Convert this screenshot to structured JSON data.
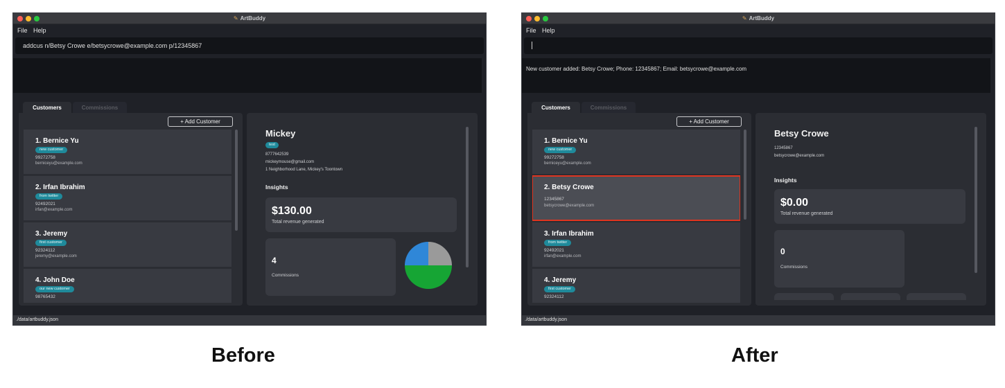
{
  "before": {
    "app_title": "ArtBuddy",
    "menu": [
      "File",
      "Help"
    ],
    "command_input": "addcus n/Betsy Crowe e/betsycrowe@example.com p/12345867",
    "result_text": "",
    "tabs": [
      "Customers",
      "Commissions"
    ],
    "add_button": "+ Add Customer",
    "customers": [
      {
        "name": "1.  Bernice Yu",
        "tag": "new customer",
        "phone": "99272758",
        "email": "berniceyu@example.com"
      },
      {
        "name": "2.  Irfan Ibrahim",
        "tag": "from twitter",
        "phone": "92492021",
        "email": "irfan@example.com"
      },
      {
        "name": "3.  Jeremy",
        "tag": "first customer",
        "phone": "92324112",
        "email": "jeremy@example.com"
      },
      {
        "name": "4.  John Doe",
        "tag": "our new customer",
        "phone": "98765432",
        "email": ""
      }
    ],
    "detail": {
      "name": "Mickey",
      "tag": "test",
      "phone": "8777642539",
      "email": "mickeymouse@gmail.com",
      "address": "1 Neighborhood Lane, Mickey's Toontown",
      "insights_label": "Insights",
      "revenue": "$130.00",
      "revenue_label": "Total revenue generated",
      "commissions_count": "4",
      "commissions_label": "Commissions"
    },
    "pie_chart": {
      "colors": [
        "#2f87d8",
        "#9a9a9a",
        "#16a534"
      ]
    },
    "status_path": "./data/artbuddy.json",
    "caption": "Before"
  },
  "after": {
    "app_title": "ArtBuddy",
    "menu": [
      "File",
      "Help"
    ],
    "command_input": "",
    "result_text": "New customer added: Betsy Crowe; Phone: 12345867; Email: betsycrowe@example.com",
    "tabs": [
      "Customers",
      "Commissions"
    ],
    "add_button": "+ Add Customer",
    "customers": [
      {
        "name": "1.  Bernice Yu",
        "tag": "new customer",
        "phone": "99272758",
        "email": "berniceyu@example.com"
      },
      {
        "name": "2.  Betsy Crowe",
        "tag": "",
        "phone": "12345867",
        "email": "betsycrowe@example.com"
      },
      {
        "name": "3.  Irfan Ibrahim",
        "tag": "from twitter",
        "phone": "92492021",
        "email": "irfan@example.com"
      },
      {
        "name": "4.  Jeremy",
        "tag": "first customer",
        "phone": "92324112",
        "email": ""
      }
    ],
    "selected_customer": "2.  Betsy Crowe",
    "detail": {
      "name": "Betsy Crowe",
      "phone": "12345867",
      "email": "betsycrowe@example.com",
      "insights_label": "Insights",
      "revenue": "$0.00",
      "revenue_label": "Total revenue generated",
      "commissions_count": "0",
      "commissions_label": "Commissions"
    },
    "status_path": "./data/artbuddy.json",
    "caption": "After"
  },
  "colors": {
    "window_bg": "#1f2127",
    "panel_bg": "#2b2d33",
    "card_bg": "#383a41",
    "tag_bg": "#1f8a9b",
    "selection_outline": "#e0341f"
  }
}
